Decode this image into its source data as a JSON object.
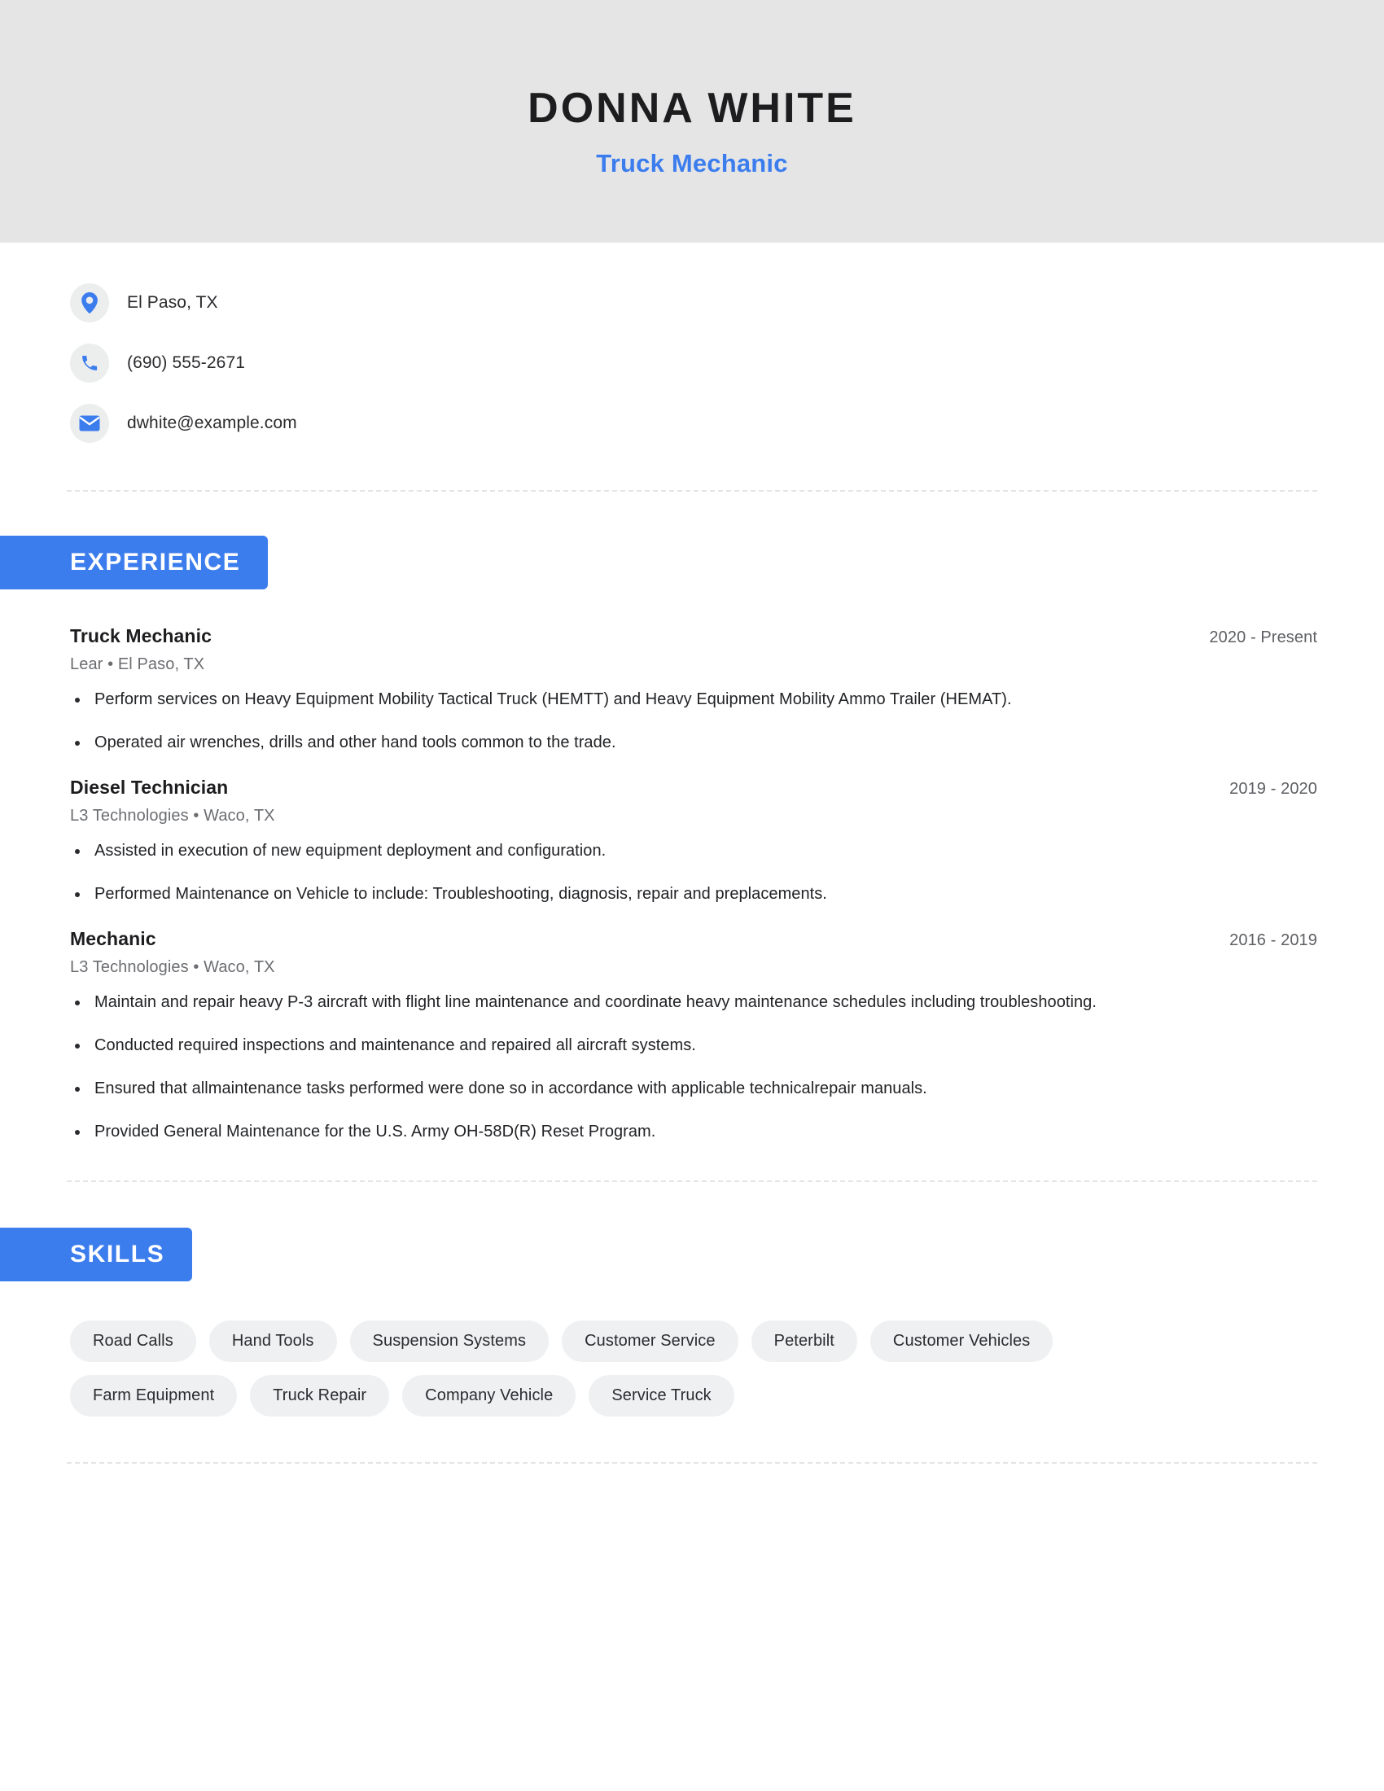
{
  "header": {
    "name": "DONNA WHITE",
    "job_title": "Truck Mechanic",
    "background_color": "#e5e5e5",
    "accent_color": "#3c7dee"
  },
  "contact": {
    "location": "El Paso, TX",
    "phone": "(690) 555-2671",
    "email": "dwhite@example.com",
    "icons": {
      "location": "map-pin-icon",
      "phone": "phone-icon",
      "email": "envelope-icon"
    }
  },
  "sections": {
    "experience_label": "EXPERIENCE",
    "skills_label": "SKILLS"
  },
  "experience": [
    {
      "role": "Truck Mechanic",
      "dates": "2020 - Present",
      "company": "Lear",
      "location": "El Paso, TX",
      "meta": "Lear  •  El Paso, TX",
      "bullets": [
        "Perform services on Heavy Equipment Mobility Tactical Truck (HEMTT) and Heavy Equipment Mobility Ammo Trailer (HEMAT).",
        "Operated air wrenches, drills and other hand tools common to the trade."
      ]
    },
    {
      "role": "Diesel Technician",
      "dates": "2019 - 2020",
      "company": "L3 Technologies",
      "location": "Waco, TX",
      "meta": "L3 Technologies  •  Waco, TX",
      "bullets": [
        "Assisted in execution of new equipment deployment and configuration.",
        "Performed Maintenance on Vehicle to include: Troubleshooting, diagnosis, repair and preplacements."
      ]
    },
    {
      "role": "Mechanic",
      "dates": "2016 - 2019",
      "company": "L3 Technologies",
      "location": "Waco, TX",
      "meta": "L3 Technologies  •  Waco, TX",
      "bullets": [
        "Maintain and repair heavy P-3 aircraft with flight line maintenance and coordinate heavy maintenance schedules including troubleshooting.",
        "Conducted required inspections and maintenance and repaired all aircraft systems.",
        "Ensured that allmaintenance tasks performed were done so in accordance with applicable technicalrepair manuals.",
        "Provided General Maintenance for the U.S. Army OH-58D(R) Reset Program."
      ]
    }
  ],
  "skills": [
    "Road Calls",
    "Hand Tools",
    "Suspension Systems",
    "Customer Service",
    "Peterbilt",
    "Customer Vehicles",
    "Farm Equipment",
    "Truck Repair",
    "Company Vehicle",
    "Service Truck"
  ]
}
